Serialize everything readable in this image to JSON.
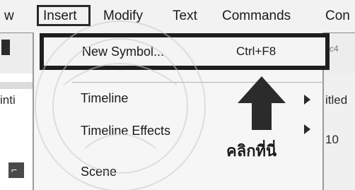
{
  "menubar": {
    "items": [
      "w",
      "Modify",
      "Text",
      "Commands",
      "Con"
    ],
    "active": "Insert"
  },
  "dropdown": {
    "new_symbol": {
      "label": "New Symbol...",
      "shortcut": "Ctrl+F8"
    },
    "items": [
      {
        "label": "Timeline",
        "has_submenu": true
      },
      {
        "label": "Timeline Effects",
        "has_submenu": true
      },
      {
        "label": "Scene",
        "has_submenu": false
      }
    ]
  },
  "annotation": {
    "text": "คลิกที่นี่"
  },
  "background": {
    "left_label": "inti",
    "right_label": "itled",
    "right_number": "10",
    "field_text": "c4"
  },
  "colors": {
    "highlight_border": "#1e1e1e",
    "menu_bg": "#f6f6f6",
    "arrow": "#2b2b2b"
  }
}
